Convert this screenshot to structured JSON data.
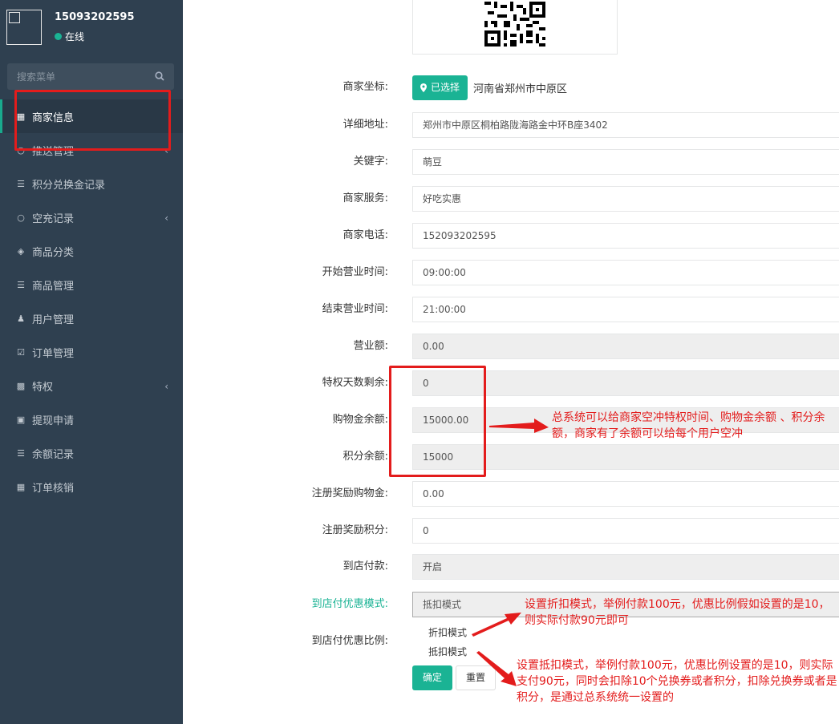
{
  "user": {
    "name": "15093202595",
    "status": "在线"
  },
  "sidebar": {
    "search_placeholder": "搜索菜单",
    "items": [
      {
        "label": "商家信息",
        "icon": "building-icon",
        "active": true
      },
      {
        "label": "推送管理",
        "icon": "circle-icon",
        "arrow": true
      },
      {
        "label": "积分兑换金记录",
        "icon": "list-icon"
      },
      {
        "label": "空充记录",
        "icon": "circle-icon",
        "arrow": true
      },
      {
        "label": "商品分类",
        "icon": "cubes-icon"
      },
      {
        "label": "商品管理",
        "icon": "list-icon"
      },
      {
        "label": "用户管理",
        "icon": "user-icon"
      },
      {
        "label": "订单管理",
        "icon": "check-square-icon"
      },
      {
        "label": "特权",
        "icon": "badge-icon",
        "arrow": true
      },
      {
        "label": "提现申请",
        "icon": "money-icon"
      },
      {
        "label": "余额记录",
        "icon": "list-icon"
      },
      {
        "label": "订单核销",
        "icon": "qrcode-icon"
      }
    ]
  },
  "form": {
    "location": {
      "label": "商家坐标:",
      "button": "已选择",
      "value": "河南省郑州市中原区"
    },
    "address": {
      "label": "详细地址:",
      "value": "郑州市中原区桐柏路陇海路金中环B座3402"
    },
    "keywords": {
      "label": "关键字:",
      "value": "萌豆"
    },
    "service": {
      "label": "商家服务:",
      "value": "好吃实惠"
    },
    "phone": {
      "label": "商家电话:",
      "value": "152093202595"
    },
    "open_time": {
      "label": "开始营业时间:",
      "value": "09:00:00"
    },
    "close_time": {
      "label": "结束营业时间:",
      "value": "21:00:00"
    },
    "revenue": {
      "label": "营业额:",
      "value": "0.00"
    },
    "privilege_days": {
      "label": "特权天数剩余:",
      "value": "0"
    },
    "shopping_balance": {
      "label": "购物金余额:",
      "value": "15000.00"
    },
    "points_balance": {
      "label": "积分余额:",
      "value": "15000"
    },
    "reg_reward_money": {
      "label": "注册奖励购物金:",
      "value": "0.00"
    },
    "reg_reward_points": {
      "label": "注册奖励积分:",
      "value": "0"
    },
    "store_pay": {
      "label": "到店付款:",
      "value": "开启"
    },
    "discount_mode": {
      "label": "到店付优惠模式:",
      "value": "抵扣模式",
      "options": [
        "折扣模式",
        "抵扣模式"
      ]
    },
    "discount_ratio": {
      "label": "到店付优惠比例:"
    },
    "ok_button": "确定",
    "reset_button": "重置"
  },
  "annotations": {
    "note1": "总系统可以给商家空冲特权时间、购物金余额 、积分余额，商家有了余额可以给每个用户空冲",
    "note2": "设置折扣模式，举例付款100元，优惠比例假如设置的是10，则实际付款90元即可",
    "note3": "设置抵扣模式，举例付款100元，优惠比例设置的是10，则实际支付90元，同时会扣除10个兑换券或者积分，扣除兑换券或者是积分，是通过总系统统一设置的",
    "color": "#e31c1c"
  },
  "colors": {
    "sidebar": "#2f4050",
    "accent": "#1ab394"
  }
}
